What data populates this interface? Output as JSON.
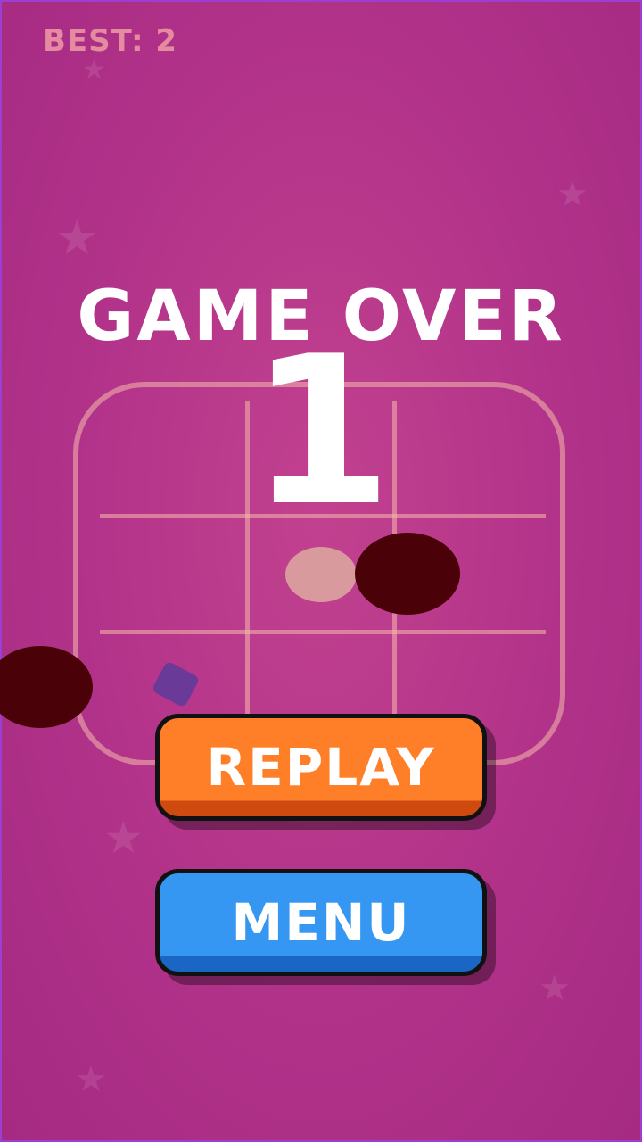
{
  "hud": {
    "best_text": "BEST: 2"
  },
  "game_over": {
    "title": "GAME OVER",
    "score": "1"
  },
  "buttons": {
    "replay": "REPLAY",
    "menu": "MENU"
  },
  "colors": {
    "background": "#b13289",
    "replay": "#ff7f29",
    "menu": "#3597f2",
    "dark_puck": "#4a0208",
    "light_puck": "#d99a9e",
    "diamond": "#6a3a98"
  }
}
